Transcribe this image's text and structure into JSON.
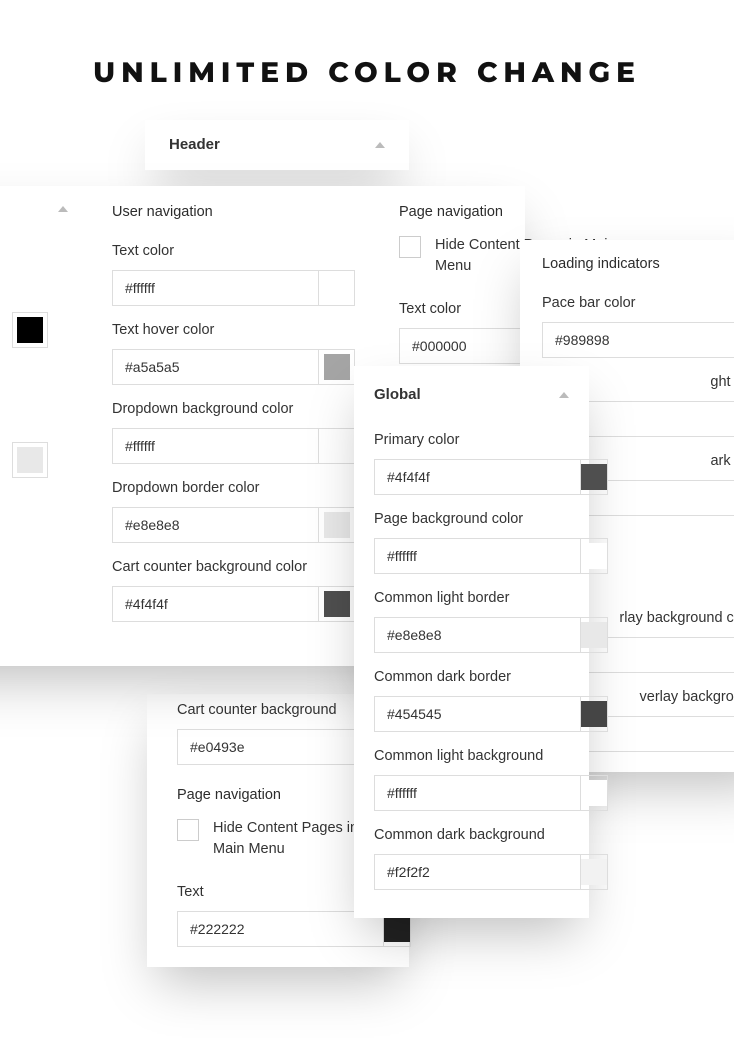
{
  "title": "UNLIMITED COLOR CHANGE",
  "header_panel": {
    "title": "Header"
  },
  "usernav": {
    "user_heading": "User navigation",
    "page_heading": "Page navigation",
    "text_color_label": "Text color",
    "text_color_value": "#ffffff",
    "text_hover_label": "Text hover color",
    "text_hover_value": "#a5a5a5",
    "dropdown_bg_label": "Dropdown background color",
    "dropdown_bg_value": "#ffffff",
    "dropdown_border_label": "Dropdown border color",
    "dropdown_border_value": "#e8e8e8",
    "cart_counter_bg_label": "Cart counter background color",
    "cart_counter_bg_value": "#4f4f4f",
    "hide_pages_label": "Hide Content Pages in Main Menu",
    "page_text_color_label": "Text color",
    "page_text_color_value": "#000000"
  },
  "cont": {
    "cart_counter_bg_label": "Cart counter background",
    "cart_counter_bg_value": "#e0493e",
    "page_heading": "Page navigation",
    "hide_pages_label": "Hide Content Pages in Main Menu",
    "text_label": "Text",
    "text_value": "#222222"
  },
  "loading": {
    "heading": "Loading indicators",
    "pace_label": "Pace bar color",
    "pace_value": "#989898",
    "light_half_frag": "ght half",
    "dark_half_frag": "ark half",
    "overlay_bg_color_frag": "rlay background color",
    "close_overlay_frag": "verlay background"
  },
  "global": {
    "heading": "Global",
    "primary_label": "Primary color",
    "primary_value": "#4f4f4f",
    "page_bg_label": "Page background color",
    "page_bg_value": "#ffffff",
    "light_border_label": "Common light border",
    "light_border_value": "#e8e8e8",
    "dark_border_label": "Common dark border",
    "dark_border_value": "#454545",
    "light_bg_label": "Common light background",
    "light_bg_value": "#ffffff",
    "dark_bg_label": "Common dark background",
    "dark_bg_value": "#f2f2f2"
  }
}
